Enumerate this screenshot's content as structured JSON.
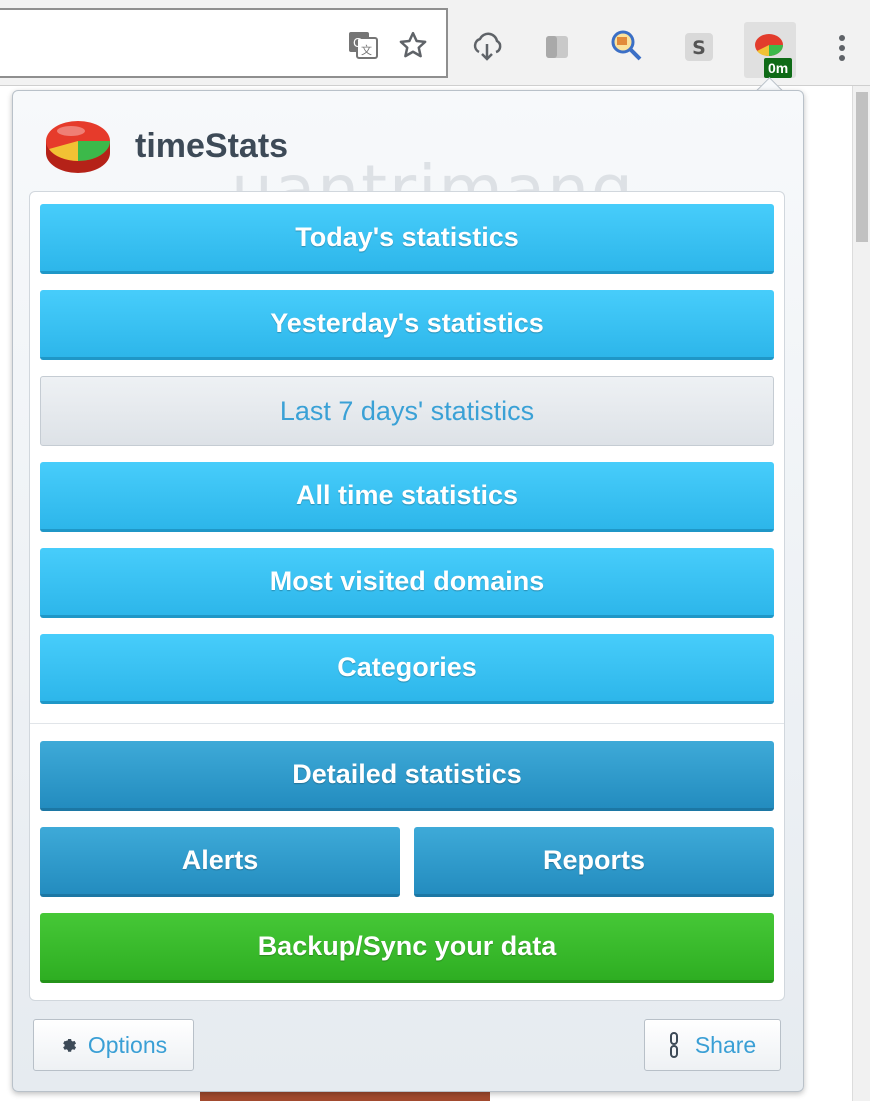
{
  "toolbar": {
    "icons": [
      "translate-icon",
      "bookmark-star-icon",
      "cloud-download-icon",
      "extension-icon",
      "magnifier-extension-icon",
      "skype-icon",
      "timestats-icon",
      "more-menu-icon"
    ],
    "timestats_badge": "0m"
  },
  "watermark": "uantrimang",
  "popup": {
    "title": "timeStats",
    "menu": [
      {
        "label": "Today's statistics"
      },
      {
        "label": "Yesterday's statistics"
      },
      {
        "label": "Last 7 days' statistics",
        "active": true
      },
      {
        "label": "All time statistics"
      },
      {
        "label": "Most visited domains"
      },
      {
        "label": "Categories"
      }
    ],
    "detailed_label": "Detailed statistics",
    "alerts_label": "Alerts",
    "reports_label": "Reports",
    "backup_label": "Backup/Sync your data",
    "options_label": "Options",
    "share_label": "Share"
  },
  "colors": {
    "primary_button": "#36bff0",
    "dark_button": "#2b99cc",
    "green_button": "#39bb2c",
    "active_text": "#3aa1d6"
  }
}
